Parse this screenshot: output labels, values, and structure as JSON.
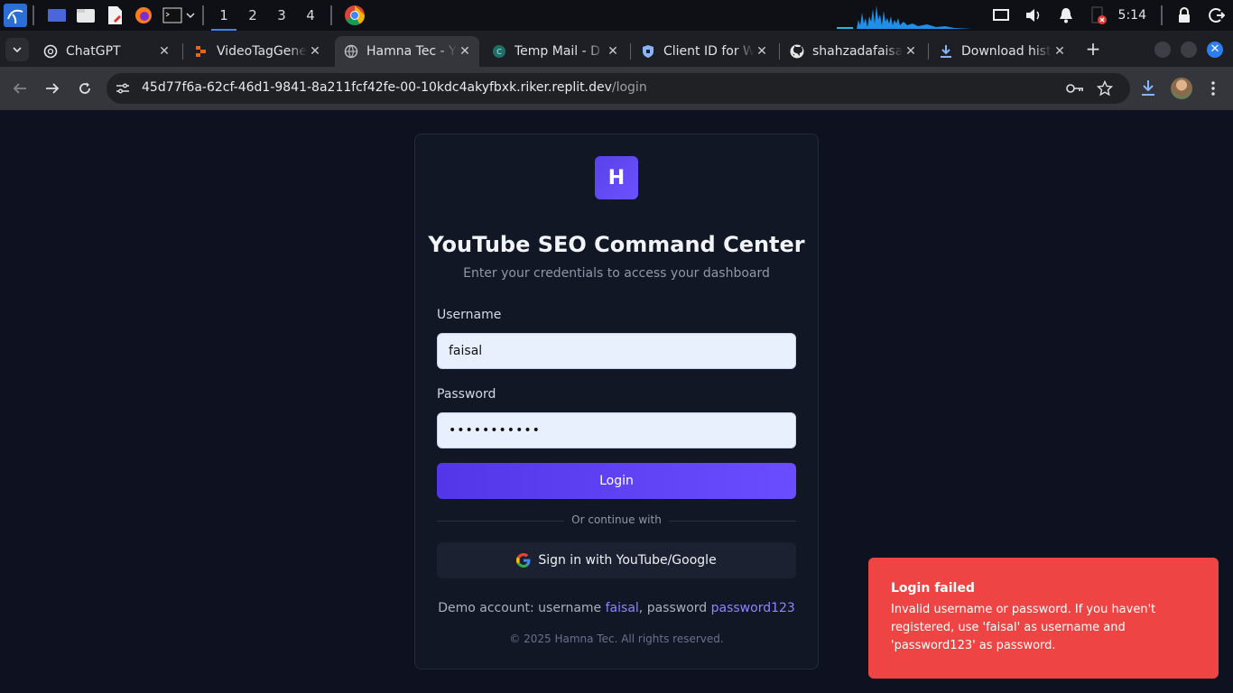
{
  "taskbar": {
    "workspaces": [
      "1",
      "2",
      "3",
      "4"
    ],
    "active_workspace": "1",
    "clock": "5:14"
  },
  "tabs": [
    {
      "title": "ChatGPT",
      "icon": "chatgpt-icon",
      "active": false
    },
    {
      "title": "VideoTagGene",
      "icon": "replit-icon",
      "active": false
    },
    {
      "title": "Hamna Tec - Y",
      "icon": "globe-icon",
      "active": true
    },
    {
      "title": "Temp Mail - D",
      "icon": "tempmail-icon",
      "active": false
    },
    {
      "title": "Client ID for W",
      "icon": "shield-icon",
      "active": false
    },
    {
      "title": "shahzadafaisa",
      "icon": "github-icon",
      "active": false
    },
    {
      "title": "Download hist",
      "icon": "download-icon",
      "active": false
    }
  ],
  "address_bar": {
    "host": "45d77f6a-62cf-46d1-9841-8a211fcf42fe-00-10kdc4akyfbxk.riker.replit.dev",
    "path": "/login"
  },
  "login": {
    "logo_letter": "H",
    "title": "YouTube SEO Command Center",
    "subtitle": "Enter your credentials to access your dashboard",
    "username_label": "Username",
    "username_value": "faisal",
    "password_label": "Password",
    "password_value": "•••••••••••",
    "login_button": "Login",
    "divider_text": "Or continue with",
    "google_button": "Sign in with YouTube/Google",
    "demo_prefix": "Demo account: username ",
    "demo_username": "faisal",
    "demo_middle": ", password ",
    "demo_password": "password123",
    "copyright": "© 2025 Hamna Tec. All rights reserved."
  },
  "toast": {
    "title": "Login failed",
    "message": "Invalid username or password. If you haven't registered, use 'faisal' as username and 'password123' as password."
  },
  "colors": {
    "page_bg": "#0e1220",
    "accent": "#5b3ff0",
    "error": "#ef4444"
  }
}
